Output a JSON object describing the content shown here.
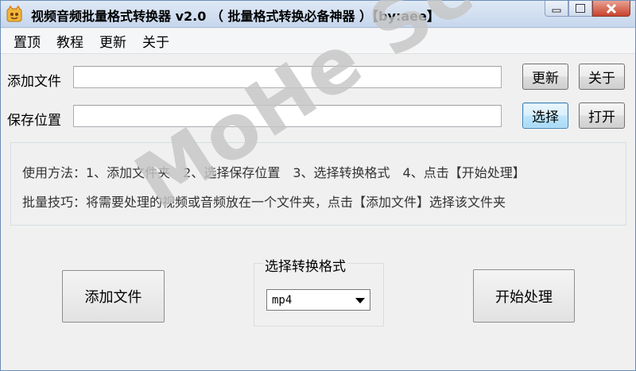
{
  "window": {
    "title": "视频音频批量格式转换器 v2.0 （ 批量格式转换必备神器 ）【by:aee】"
  },
  "menu": {
    "items": [
      "置顶",
      "教程",
      "更新",
      "关于"
    ]
  },
  "add_file": {
    "label": "添加文件",
    "value": ""
  },
  "save_location": {
    "label": "保存位置",
    "value": ""
  },
  "buttons": {
    "update": "更新",
    "about": "关于",
    "choose": "选择",
    "open": "打开",
    "add_file_big": "添加文件",
    "start": "开始处理"
  },
  "instructions": {
    "line1": "使用方法：1、添加文件夹　2、选择保存位置　3、选择转换格式　4、点击【开始处理】",
    "line2": "批量技巧：将需要处理的视频或音频放在一个文件夹，点击【添加文件】选择该文件夹"
  },
  "format": {
    "label": "选择转换格式",
    "selected": "mp4"
  },
  "watermark": {
    "text": "MoHe Sc.com"
  },
  "icons": {
    "app": "app-icon",
    "minimize": "minimize-icon",
    "maximize": "maximize-icon",
    "close": "close-icon",
    "dropdown": "chevron-down-icon"
  },
  "colors": {
    "titlebar": "#c6d6ec",
    "close_button": "#c7432c",
    "focused_button": "#bee6fd"
  }
}
